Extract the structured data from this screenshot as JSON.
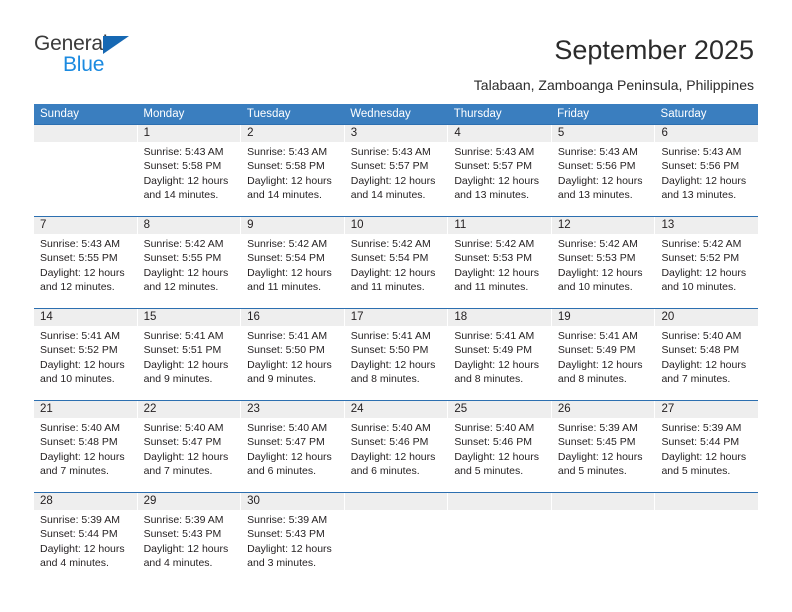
{
  "brand": {
    "name_top": "General",
    "name_bottom": "Blue",
    "accent_color": "#1668b3",
    "accent_color_light": "#1b8ae0"
  },
  "header": {
    "title": "September 2025",
    "subtitle": "Talabaan, Zamboanga Peninsula, Philippines"
  },
  "calendar": {
    "header_bg": "#3a7ebf",
    "row_border": "#2c6fb0",
    "daynum_bg": "#eeeeee",
    "weekdays": [
      "Sunday",
      "Monday",
      "Tuesday",
      "Wednesday",
      "Thursday",
      "Friday",
      "Saturday"
    ],
    "weeks": [
      [
        {
          "day": "",
          "sunrise": "",
          "sunset": "",
          "daylight": ""
        },
        {
          "day": "1",
          "sunrise": "Sunrise: 5:43 AM",
          "sunset": "Sunset: 5:58 PM",
          "daylight": "Daylight: 12 hours and 14 minutes."
        },
        {
          "day": "2",
          "sunrise": "Sunrise: 5:43 AM",
          "sunset": "Sunset: 5:58 PM",
          "daylight": "Daylight: 12 hours and 14 minutes."
        },
        {
          "day": "3",
          "sunrise": "Sunrise: 5:43 AM",
          "sunset": "Sunset: 5:57 PM",
          "daylight": "Daylight: 12 hours and 14 minutes."
        },
        {
          "day": "4",
          "sunrise": "Sunrise: 5:43 AM",
          "sunset": "Sunset: 5:57 PM",
          "daylight": "Daylight: 12 hours and 13 minutes."
        },
        {
          "day": "5",
          "sunrise": "Sunrise: 5:43 AM",
          "sunset": "Sunset: 5:56 PM",
          "daylight": "Daylight: 12 hours and 13 minutes."
        },
        {
          "day": "6",
          "sunrise": "Sunrise: 5:43 AM",
          "sunset": "Sunset: 5:56 PM",
          "daylight": "Daylight: 12 hours and 13 minutes."
        }
      ],
      [
        {
          "day": "7",
          "sunrise": "Sunrise: 5:43 AM",
          "sunset": "Sunset: 5:55 PM",
          "daylight": "Daylight: 12 hours and 12 minutes."
        },
        {
          "day": "8",
          "sunrise": "Sunrise: 5:42 AM",
          "sunset": "Sunset: 5:55 PM",
          "daylight": "Daylight: 12 hours and 12 minutes."
        },
        {
          "day": "9",
          "sunrise": "Sunrise: 5:42 AM",
          "sunset": "Sunset: 5:54 PM",
          "daylight": "Daylight: 12 hours and 11 minutes."
        },
        {
          "day": "10",
          "sunrise": "Sunrise: 5:42 AM",
          "sunset": "Sunset: 5:54 PM",
          "daylight": "Daylight: 12 hours and 11 minutes."
        },
        {
          "day": "11",
          "sunrise": "Sunrise: 5:42 AM",
          "sunset": "Sunset: 5:53 PM",
          "daylight": "Daylight: 12 hours and 11 minutes."
        },
        {
          "day": "12",
          "sunrise": "Sunrise: 5:42 AM",
          "sunset": "Sunset: 5:53 PM",
          "daylight": "Daylight: 12 hours and 10 minutes."
        },
        {
          "day": "13",
          "sunrise": "Sunrise: 5:42 AM",
          "sunset": "Sunset: 5:52 PM",
          "daylight": "Daylight: 12 hours and 10 minutes."
        }
      ],
      [
        {
          "day": "14",
          "sunrise": "Sunrise: 5:41 AM",
          "sunset": "Sunset: 5:52 PM",
          "daylight": "Daylight: 12 hours and 10 minutes."
        },
        {
          "day": "15",
          "sunrise": "Sunrise: 5:41 AM",
          "sunset": "Sunset: 5:51 PM",
          "daylight": "Daylight: 12 hours and 9 minutes."
        },
        {
          "day": "16",
          "sunrise": "Sunrise: 5:41 AM",
          "sunset": "Sunset: 5:50 PM",
          "daylight": "Daylight: 12 hours and 9 minutes."
        },
        {
          "day": "17",
          "sunrise": "Sunrise: 5:41 AM",
          "sunset": "Sunset: 5:50 PM",
          "daylight": "Daylight: 12 hours and 8 minutes."
        },
        {
          "day": "18",
          "sunrise": "Sunrise: 5:41 AM",
          "sunset": "Sunset: 5:49 PM",
          "daylight": "Daylight: 12 hours and 8 minutes."
        },
        {
          "day": "19",
          "sunrise": "Sunrise: 5:41 AM",
          "sunset": "Sunset: 5:49 PM",
          "daylight": "Daylight: 12 hours and 8 minutes."
        },
        {
          "day": "20",
          "sunrise": "Sunrise: 5:40 AM",
          "sunset": "Sunset: 5:48 PM",
          "daylight": "Daylight: 12 hours and 7 minutes."
        }
      ],
      [
        {
          "day": "21",
          "sunrise": "Sunrise: 5:40 AM",
          "sunset": "Sunset: 5:48 PM",
          "daylight": "Daylight: 12 hours and 7 minutes."
        },
        {
          "day": "22",
          "sunrise": "Sunrise: 5:40 AM",
          "sunset": "Sunset: 5:47 PM",
          "daylight": "Daylight: 12 hours and 7 minutes."
        },
        {
          "day": "23",
          "sunrise": "Sunrise: 5:40 AM",
          "sunset": "Sunset: 5:47 PM",
          "daylight": "Daylight: 12 hours and 6 minutes."
        },
        {
          "day": "24",
          "sunrise": "Sunrise: 5:40 AM",
          "sunset": "Sunset: 5:46 PM",
          "daylight": "Daylight: 12 hours and 6 minutes."
        },
        {
          "day": "25",
          "sunrise": "Sunrise: 5:40 AM",
          "sunset": "Sunset: 5:46 PM",
          "daylight": "Daylight: 12 hours and 5 minutes."
        },
        {
          "day": "26",
          "sunrise": "Sunrise: 5:39 AM",
          "sunset": "Sunset: 5:45 PM",
          "daylight": "Daylight: 12 hours and 5 minutes."
        },
        {
          "day": "27",
          "sunrise": "Sunrise: 5:39 AM",
          "sunset": "Sunset: 5:44 PM",
          "daylight": "Daylight: 12 hours and 5 minutes."
        }
      ],
      [
        {
          "day": "28",
          "sunrise": "Sunrise: 5:39 AM",
          "sunset": "Sunset: 5:44 PM",
          "daylight": "Daylight: 12 hours and 4 minutes."
        },
        {
          "day": "29",
          "sunrise": "Sunrise: 5:39 AM",
          "sunset": "Sunset: 5:43 PM",
          "daylight": "Daylight: 12 hours and 4 minutes."
        },
        {
          "day": "30",
          "sunrise": "Sunrise: 5:39 AM",
          "sunset": "Sunset: 5:43 PM",
          "daylight": "Daylight: 12 hours and 3 minutes."
        },
        {
          "day": "",
          "sunrise": "",
          "sunset": "",
          "daylight": ""
        },
        {
          "day": "",
          "sunrise": "",
          "sunset": "",
          "daylight": ""
        },
        {
          "day": "",
          "sunrise": "",
          "sunset": "",
          "daylight": ""
        },
        {
          "day": "",
          "sunrise": "",
          "sunset": "",
          "daylight": ""
        }
      ]
    ]
  }
}
